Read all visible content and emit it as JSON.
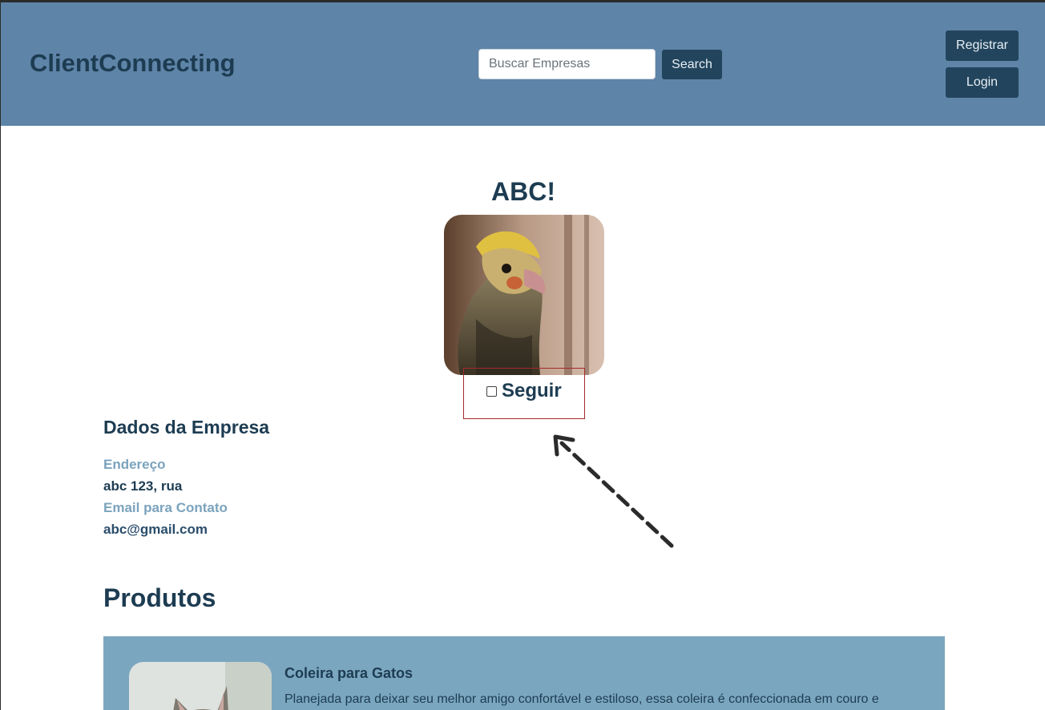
{
  "header": {
    "brand": "ClientConnecting",
    "search": {
      "placeholder": "Buscar Empresas",
      "value": "",
      "button_label": "Search"
    },
    "nav": {
      "register_label": "Registrar",
      "login_label": "Login"
    }
  },
  "company": {
    "name": "ABC!",
    "follow_label": "Seguir",
    "follow_checked": false
  },
  "details": {
    "heading": "Dados da Empresa",
    "address_label": "Endereço",
    "address_value": "abc 123, rua",
    "email_label": "Email para Contato",
    "email_value": "abc@gmail.com"
  },
  "products": {
    "heading": "Produtos",
    "items": [
      {
        "name": "Coleira para Gatos",
        "description": "Planejada para deixar seu melhor amigo confortável e estiloso, essa coleira é confeccionada em couro e"
      }
    ]
  },
  "colors": {
    "header_bg": "#5e84a8",
    "primary_dark": "#22455d",
    "card_bg": "#7ba6c0",
    "label_muted": "#7ba3bd",
    "highlight_border": "#a52a2a"
  }
}
